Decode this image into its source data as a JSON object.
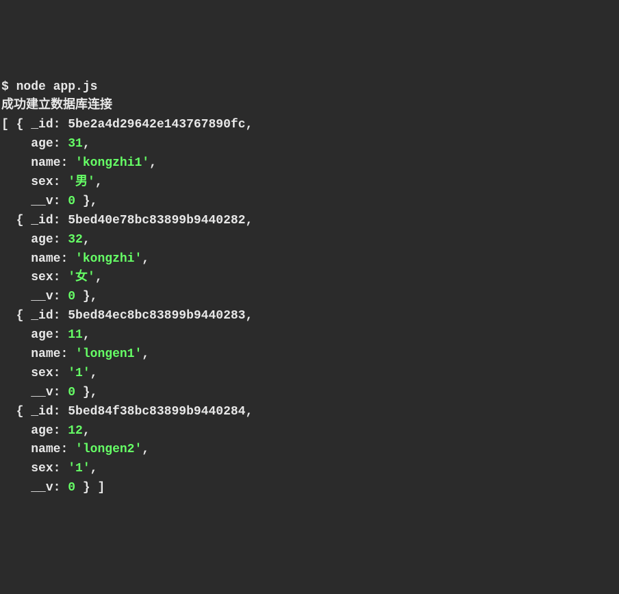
{
  "prompt": "$ node app.js",
  "connection_msg": "成功建立数据库连接",
  "records": [
    {
      "_id": "5be2a4d29642e143767890fc",
      "age": 31,
      "name": "kongzhi1",
      "sex": "男",
      "__v": 0
    },
    {
      "_id": "5bed40e78bc83899b9440282",
      "age": 32,
      "name": "kongzhi",
      "sex": "女",
      "__v": 0
    },
    {
      "_id": "5bed84ec8bc83899b9440283",
      "age": 11,
      "name": "longen1",
      "sex": "1",
      "__v": 0
    },
    {
      "_id": "5bed84f38bc83899b9440284",
      "age": 12,
      "name": "longen2",
      "sex": "1",
      "__v": 0
    }
  ],
  "labels": {
    "id": "_id",
    "age": "age",
    "name": "name",
    "sex": "sex",
    "v": "__v"
  }
}
